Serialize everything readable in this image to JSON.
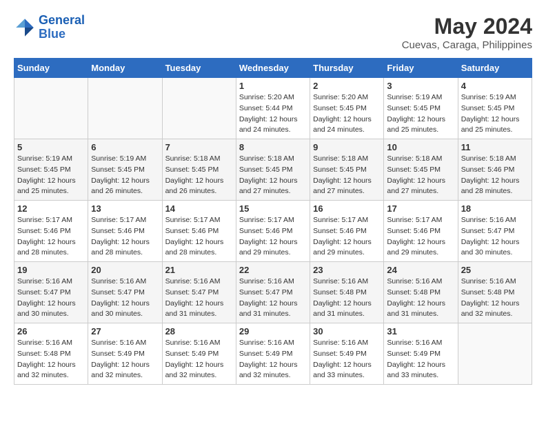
{
  "header": {
    "logo_line1": "General",
    "logo_line2": "Blue",
    "title": "May 2024",
    "subtitle": "Cuevas, Caraga, Philippines"
  },
  "calendar": {
    "days_of_week": [
      "Sunday",
      "Monday",
      "Tuesday",
      "Wednesday",
      "Thursday",
      "Friday",
      "Saturday"
    ],
    "weeks": [
      [
        {
          "day": "",
          "info": ""
        },
        {
          "day": "",
          "info": ""
        },
        {
          "day": "",
          "info": ""
        },
        {
          "day": "1",
          "info": "Sunrise: 5:20 AM\nSunset: 5:44 PM\nDaylight: 12 hours and 24 minutes."
        },
        {
          "day": "2",
          "info": "Sunrise: 5:20 AM\nSunset: 5:45 PM\nDaylight: 12 hours and 24 minutes."
        },
        {
          "day": "3",
          "info": "Sunrise: 5:19 AM\nSunset: 5:45 PM\nDaylight: 12 hours and 25 minutes."
        },
        {
          "day": "4",
          "info": "Sunrise: 5:19 AM\nSunset: 5:45 PM\nDaylight: 12 hours and 25 minutes."
        }
      ],
      [
        {
          "day": "5",
          "info": "Sunrise: 5:19 AM\nSunset: 5:45 PM\nDaylight: 12 hours and 25 minutes."
        },
        {
          "day": "6",
          "info": "Sunrise: 5:19 AM\nSunset: 5:45 PM\nDaylight: 12 hours and 26 minutes."
        },
        {
          "day": "7",
          "info": "Sunrise: 5:18 AM\nSunset: 5:45 PM\nDaylight: 12 hours and 26 minutes."
        },
        {
          "day": "8",
          "info": "Sunrise: 5:18 AM\nSunset: 5:45 PM\nDaylight: 12 hours and 27 minutes."
        },
        {
          "day": "9",
          "info": "Sunrise: 5:18 AM\nSunset: 5:45 PM\nDaylight: 12 hours and 27 minutes."
        },
        {
          "day": "10",
          "info": "Sunrise: 5:18 AM\nSunset: 5:45 PM\nDaylight: 12 hours and 27 minutes."
        },
        {
          "day": "11",
          "info": "Sunrise: 5:18 AM\nSunset: 5:46 PM\nDaylight: 12 hours and 28 minutes."
        }
      ],
      [
        {
          "day": "12",
          "info": "Sunrise: 5:17 AM\nSunset: 5:46 PM\nDaylight: 12 hours and 28 minutes."
        },
        {
          "day": "13",
          "info": "Sunrise: 5:17 AM\nSunset: 5:46 PM\nDaylight: 12 hours and 28 minutes."
        },
        {
          "day": "14",
          "info": "Sunrise: 5:17 AM\nSunset: 5:46 PM\nDaylight: 12 hours and 28 minutes."
        },
        {
          "day": "15",
          "info": "Sunrise: 5:17 AM\nSunset: 5:46 PM\nDaylight: 12 hours and 29 minutes."
        },
        {
          "day": "16",
          "info": "Sunrise: 5:17 AM\nSunset: 5:46 PM\nDaylight: 12 hours and 29 minutes."
        },
        {
          "day": "17",
          "info": "Sunrise: 5:17 AM\nSunset: 5:46 PM\nDaylight: 12 hours and 29 minutes."
        },
        {
          "day": "18",
          "info": "Sunrise: 5:16 AM\nSunset: 5:47 PM\nDaylight: 12 hours and 30 minutes."
        }
      ],
      [
        {
          "day": "19",
          "info": "Sunrise: 5:16 AM\nSunset: 5:47 PM\nDaylight: 12 hours and 30 minutes."
        },
        {
          "day": "20",
          "info": "Sunrise: 5:16 AM\nSunset: 5:47 PM\nDaylight: 12 hours and 30 minutes."
        },
        {
          "day": "21",
          "info": "Sunrise: 5:16 AM\nSunset: 5:47 PM\nDaylight: 12 hours and 31 minutes."
        },
        {
          "day": "22",
          "info": "Sunrise: 5:16 AM\nSunset: 5:47 PM\nDaylight: 12 hours and 31 minutes."
        },
        {
          "day": "23",
          "info": "Sunrise: 5:16 AM\nSunset: 5:48 PM\nDaylight: 12 hours and 31 minutes."
        },
        {
          "day": "24",
          "info": "Sunrise: 5:16 AM\nSunset: 5:48 PM\nDaylight: 12 hours and 31 minutes."
        },
        {
          "day": "25",
          "info": "Sunrise: 5:16 AM\nSunset: 5:48 PM\nDaylight: 12 hours and 32 minutes."
        }
      ],
      [
        {
          "day": "26",
          "info": "Sunrise: 5:16 AM\nSunset: 5:48 PM\nDaylight: 12 hours and 32 minutes."
        },
        {
          "day": "27",
          "info": "Sunrise: 5:16 AM\nSunset: 5:49 PM\nDaylight: 12 hours and 32 minutes."
        },
        {
          "day": "28",
          "info": "Sunrise: 5:16 AM\nSunset: 5:49 PM\nDaylight: 12 hours and 32 minutes."
        },
        {
          "day": "29",
          "info": "Sunrise: 5:16 AM\nSunset: 5:49 PM\nDaylight: 12 hours and 32 minutes."
        },
        {
          "day": "30",
          "info": "Sunrise: 5:16 AM\nSunset: 5:49 PM\nDaylight: 12 hours and 33 minutes."
        },
        {
          "day": "31",
          "info": "Sunrise: 5:16 AM\nSunset: 5:49 PM\nDaylight: 12 hours and 33 minutes."
        },
        {
          "day": "",
          "info": ""
        }
      ]
    ]
  }
}
